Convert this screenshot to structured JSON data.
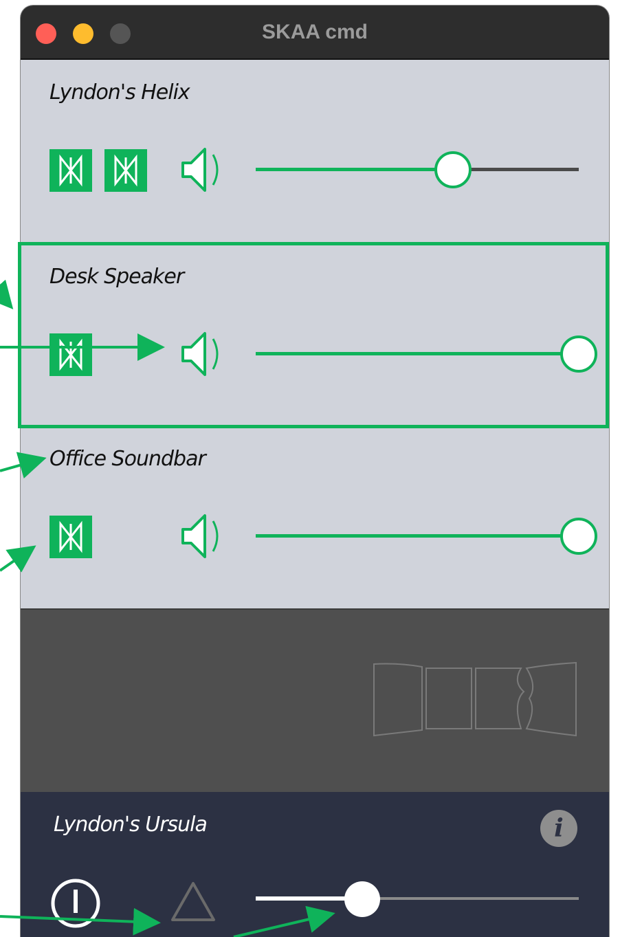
{
  "window": {
    "title": "SKAA cmd"
  },
  "colors": {
    "accent": "#0fb35a",
    "panel": "#d0d3db",
    "footer": "#2c3143",
    "grey_area": "#4f4f4f"
  },
  "devices": [
    {
      "name": "Lyndon's Helix",
      "icons": [
        "transmitter-icon",
        "transmitter-icon"
      ],
      "volume": 0.61,
      "selected": false
    },
    {
      "name": "Desk Speaker",
      "icons": [
        "transmitter-icon"
      ],
      "volume": 1.0,
      "selected": true
    },
    {
      "name": "Office Soundbar",
      "icons": [
        "transmitter-icon"
      ],
      "volume": 1.0,
      "selected": false
    }
  ],
  "footer": {
    "name": "Lyndon's Ursula",
    "info_label": "i",
    "icons": [
      "power-icon",
      "triangle-icon",
      "info-icon"
    ],
    "volume": 0.33
  }
}
